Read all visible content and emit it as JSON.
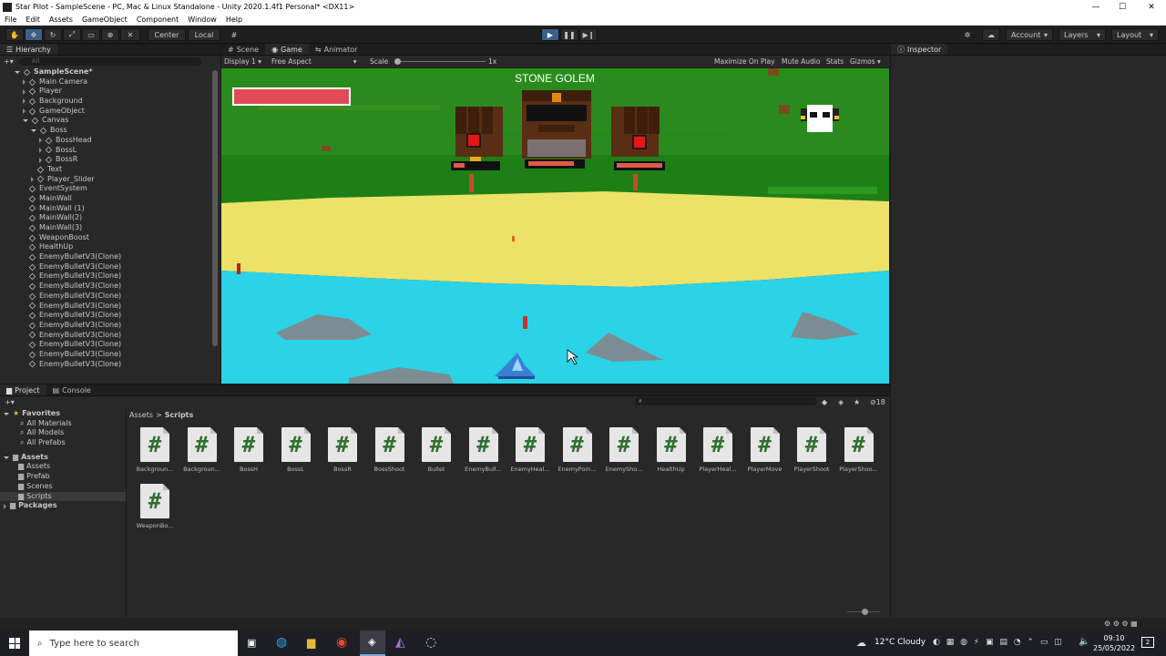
{
  "window": {
    "title": "Star Pilot - SampleScene - PC, Mac & Linux Standalone - Unity 2020.1.4f1 Personal* <DX11>"
  },
  "menu": [
    "File",
    "Edit",
    "Assets",
    "GameObject",
    "Component",
    "Window",
    "Help"
  ],
  "toolbar": {
    "center": "Center",
    "local": "Local",
    "account": "Account",
    "layers": "Layers",
    "layout": "Layout"
  },
  "hierarchy": {
    "tab": "Hierarchy",
    "search_placeholder": "All",
    "items": [
      {
        "label": "SampleScene*",
        "indent": 0
      },
      {
        "label": "Main Camera",
        "indent": 1
      },
      {
        "label": "Player",
        "indent": 1
      },
      {
        "label": "Background",
        "indent": 1
      },
      {
        "label": "GameObject",
        "indent": 1
      },
      {
        "label": "Canvas",
        "indent": 1
      },
      {
        "label": "Boss",
        "indent": 2
      },
      {
        "label": "BossHead",
        "indent": 3
      },
      {
        "label": "BossL",
        "indent": 3
      },
      {
        "label": "BossR",
        "indent": 3
      },
      {
        "label": "Text",
        "indent": 2
      },
      {
        "label": "Player_Slider",
        "indent": 2
      },
      {
        "label": "EventSystem",
        "indent": 1
      },
      {
        "label": "MainWall",
        "indent": 1
      },
      {
        "label": "MainWall (1)",
        "indent": 1
      },
      {
        "label": "MainWall(2)",
        "indent": 1
      },
      {
        "label": "MainWall(3)",
        "indent": 1
      },
      {
        "label": "WeaponBoost",
        "indent": 1
      },
      {
        "label": "HealthUp",
        "indent": 1
      },
      {
        "label": "EnemyBulletV3(Clone)",
        "indent": 1
      },
      {
        "label": "EnemyBulletV3(Clone)",
        "indent": 1
      },
      {
        "label": "EnemyBulletV3(Clone)",
        "indent": 1
      },
      {
        "label": "EnemyBulletV3(Clone)",
        "indent": 1
      },
      {
        "label": "EnemyBulletV3(Clone)",
        "indent": 1
      },
      {
        "label": "EnemyBulletV3(Clone)",
        "indent": 1
      },
      {
        "label": "EnemyBulletV3(Clone)",
        "indent": 1
      },
      {
        "label": "EnemyBulletV3(Clone)",
        "indent": 1
      },
      {
        "label": "EnemyBulletV3(Clone)",
        "indent": 1
      },
      {
        "label": "EnemyBulletV3(Clone)",
        "indent": 1
      },
      {
        "label": "EnemyBulletV3(Clone)",
        "indent": 1
      },
      {
        "label": "EnemyBulletV3(Clone)",
        "indent": 1
      }
    ]
  },
  "scene_tabs": [
    "Scene",
    "Game",
    "Animator"
  ],
  "game_toolbar": {
    "display": "Display 1",
    "aspect": "Free Aspect",
    "scale_label": "Scale",
    "scale_value": "1x",
    "maximize": "Maximize On Play",
    "mute": "Mute Audio",
    "stats": "Stats",
    "gizmos": "Gizmos"
  },
  "game": {
    "boss_name": "STONE GOLEM",
    "player_health": 1.0
  },
  "inspector": {
    "tab": "Inspector"
  },
  "project": {
    "tabs": [
      "Project",
      "Console"
    ],
    "favorites": {
      "label": "Favorites",
      "items": [
        "All Materials",
        "All Models",
        "All Prefabs"
      ]
    },
    "assets": {
      "label": "Assets",
      "items": [
        "Assets",
        "Prefab",
        "Scenes",
        "Scripts"
      ]
    },
    "packages": "Packages",
    "breadcrumb": [
      "Assets",
      "Scripts"
    ],
    "hidden_count": "18",
    "scripts": [
      "Backgroun...",
      "Backgroun...",
      "BossH",
      "BossL",
      "BossR",
      "BossShoot",
      "Bullet",
      "EnemyBull...",
      "EnemyHeal...",
      "EnemyPoin...",
      "EnemySho...",
      "HealthUp",
      "PlayerHeal...",
      "PlayerMove",
      "PlayerShoot",
      "PlayerShoo...",
      "WeaponBo..."
    ]
  },
  "taskbar": {
    "search_placeholder": "Type here to search",
    "weather": "12°C  Cloudy",
    "time": "09:10",
    "date": "25/05/2022",
    "notification_count": "2"
  }
}
